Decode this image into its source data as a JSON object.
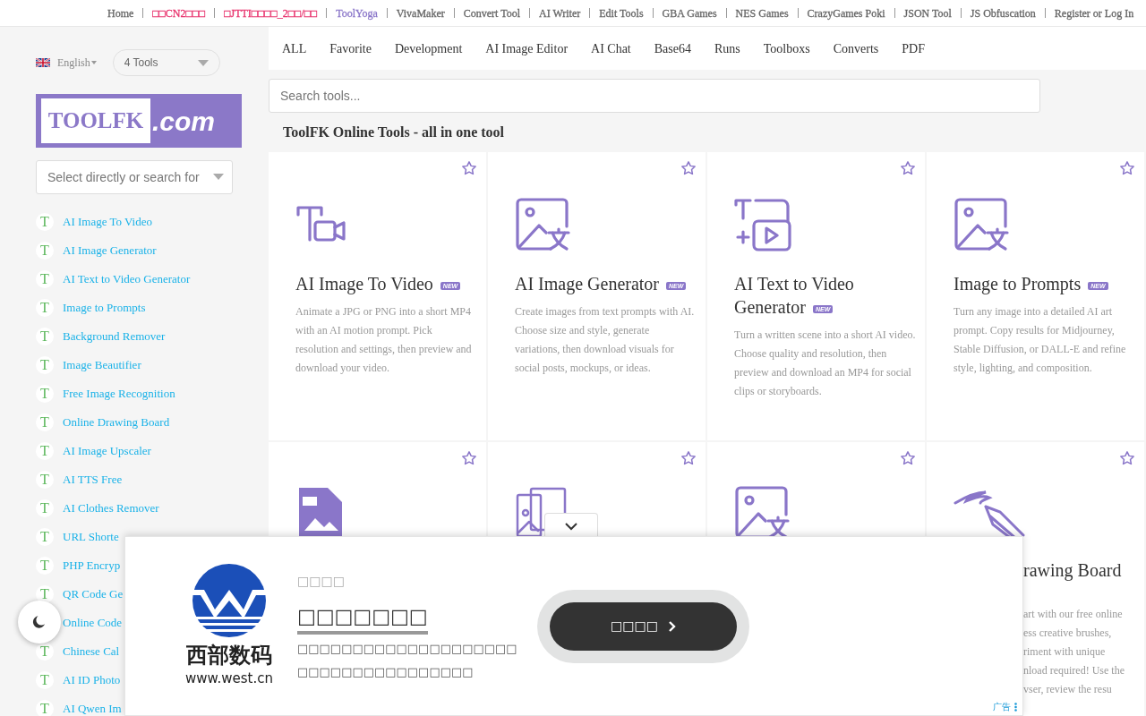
{
  "top_nav": [
    {
      "label": "Home",
      "color": "#666666"
    },
    {
      "label": "□□CN2□□□",
      "color": "#e8336d"
    },
    {
      "label": "□JTTI□□□□_2□□/□□",
      "color": "#e8336d"
    },
    {
      "label": "ToolYoga",
      "color": "#8a76c9"
    },
    {
      "label": "VivaMaker",
      "color": "#666666"
    },
    {
      "label": "Convert Tool",
      "color": "#666666"
    },
    {
      "label": "AI Writer",
      "color": "#666666"
    },
    {
      "label": "Edit Tools",
      "color": "#666666"
    },
    {
      "label": "GBA Games",
      "color": "#666666"
    },
    {
      "label": "NES Games",
      "color": "#666666"
    },
    {
      "label": "CrazyGames Poki",
      "color": "#666666"
    },
    {
      "label": "JSON Tool",
      "color": "#666666"
    },
    {
      "label": "JS Obfuscation",
      "color": "#666666"
    },
    {
      "label": "Register or Log In",
      "color": "#666666"
    }
  ],
  "sidebar": {
    "language": "English",
    "tools_select": "4 Tools",
    "logo": {
      "left": "TOOLFK",
      "right": ".com"
    },
    "tool_search": {
      "placeholder": "Select directly or search for"
    },
    "items": [
      {
        "letter": "T",
        "label": "AI Image To Video"
      },
      {
        "letter": "T",
        "label": "AI Image Generator"
      },
      {
        "letter": "T",
        "label": "AI Text to Video Generator"
      },
      {
        "letter": "T",
        "label": "Image to Prompts"
      },
      {
        "letter": "T",
        "label": "Background Remover"
      },
      {
        "letter": "T",
        "label": "Image Beautifier"
      },
      {
        "letter": "T",
        "label": "Free Image Recognition"
      },
      {
        "letter": "T",
        "label": "Online Drawing Board"
      },
      {
        "letter": "T",
        "label": "AI Image Upscaler"
      },
      {
        "letter": "T",
        "label": "AI TTS Free"
      },
      {
        "letter": "T",
        "label": "AI Clothes Remover"
      },
      {
        "letter": "T",
        "label": "URL Shorte"
      },
      {
        "letter": "T",
        "label": "PHP Encryp"
      },
      {
        "letter": "T",
        "label": "QR Code Ge"
      },
      {
        "label": "Online Code"
      },
      {
        "letter": "T",
        "label": "Chinese Cal"
      },
      {
        "letter": "T",
        "label": "AI ID Photo"
      },
      {
        "letter": "T",
        "label": "AI Qwen Im"
      }
    ]
  },
  "tabs": [
    "ALL",
    "Favorite",
    "Development",
    "AI Image Editor",
    "AI Chat",
    "Base64",
    "Runs",
    "Toolboxs",
    "Converts",
    "PDF"
  ],
  "search": {
    "placeholder": "Search tools..."
  },
  "heading": "ToolFK Online Tools - all in one tool",
  "tools": [
    {
      "favorite": false,
      "title": "AI Image To Video",
      "badge": "NEW",
      "description": "Animate a JPG or PNG into a short MP4 with an AI motion prompt. Pick resolution and settings, then preview and download your video."
    },
    {
      "favorite": false,
      "title": "AI Image Generator",
      "badge": "NEW",
      "description": "Create images from text prompts with AI. Choose size and style, generate variations, then download visuals for social posts, mockups, or ideas."
    },
    {
      "favorite": false,
      "title": "AI Text to Video Generator",
      "badge": "NEW",
      "description": "Turn a written scene into a short AI video. Choose quality and resolution, then preview and download an MP4 for social clips or storyboards."
    },
    {
      "favorite": false,
      "title": "Image to Prompts",
      "badge": "NEW",
      "description": "Turn any image into a detailed AI art prompt. Copy results for Midjourney, Stable Diffusion, or DALL-E and refine style, lighting, and composition."
    }
  ],
  "tools_partly_hidden": [
    {
      "favorite": false
    },
    {
      "favorite": false
    },
    {
      "favorite": false
    },
    {
      "favorite": false,
      "title": "rawing Board",
      "description_lines": [
        "art with our free online",
        "ess creative brushes,",
        "riment with unique",
        "nload required! Use the",
        "vser, review the resu"
      ]
    }
  ],
  "ad": {
    "logo_name": "西部数码",
    "logo_url": "www.west.cn",
    "kicker": "□□□□",
    "headline": "□□□□□□□",
    "body": [
      "□□□□□□□□□□□□□□□□□□□□",
      "□□□□□□□□□□□□□□□□"
    ],
    "button": "□□□□",
    "label": "广告"
  }
}
